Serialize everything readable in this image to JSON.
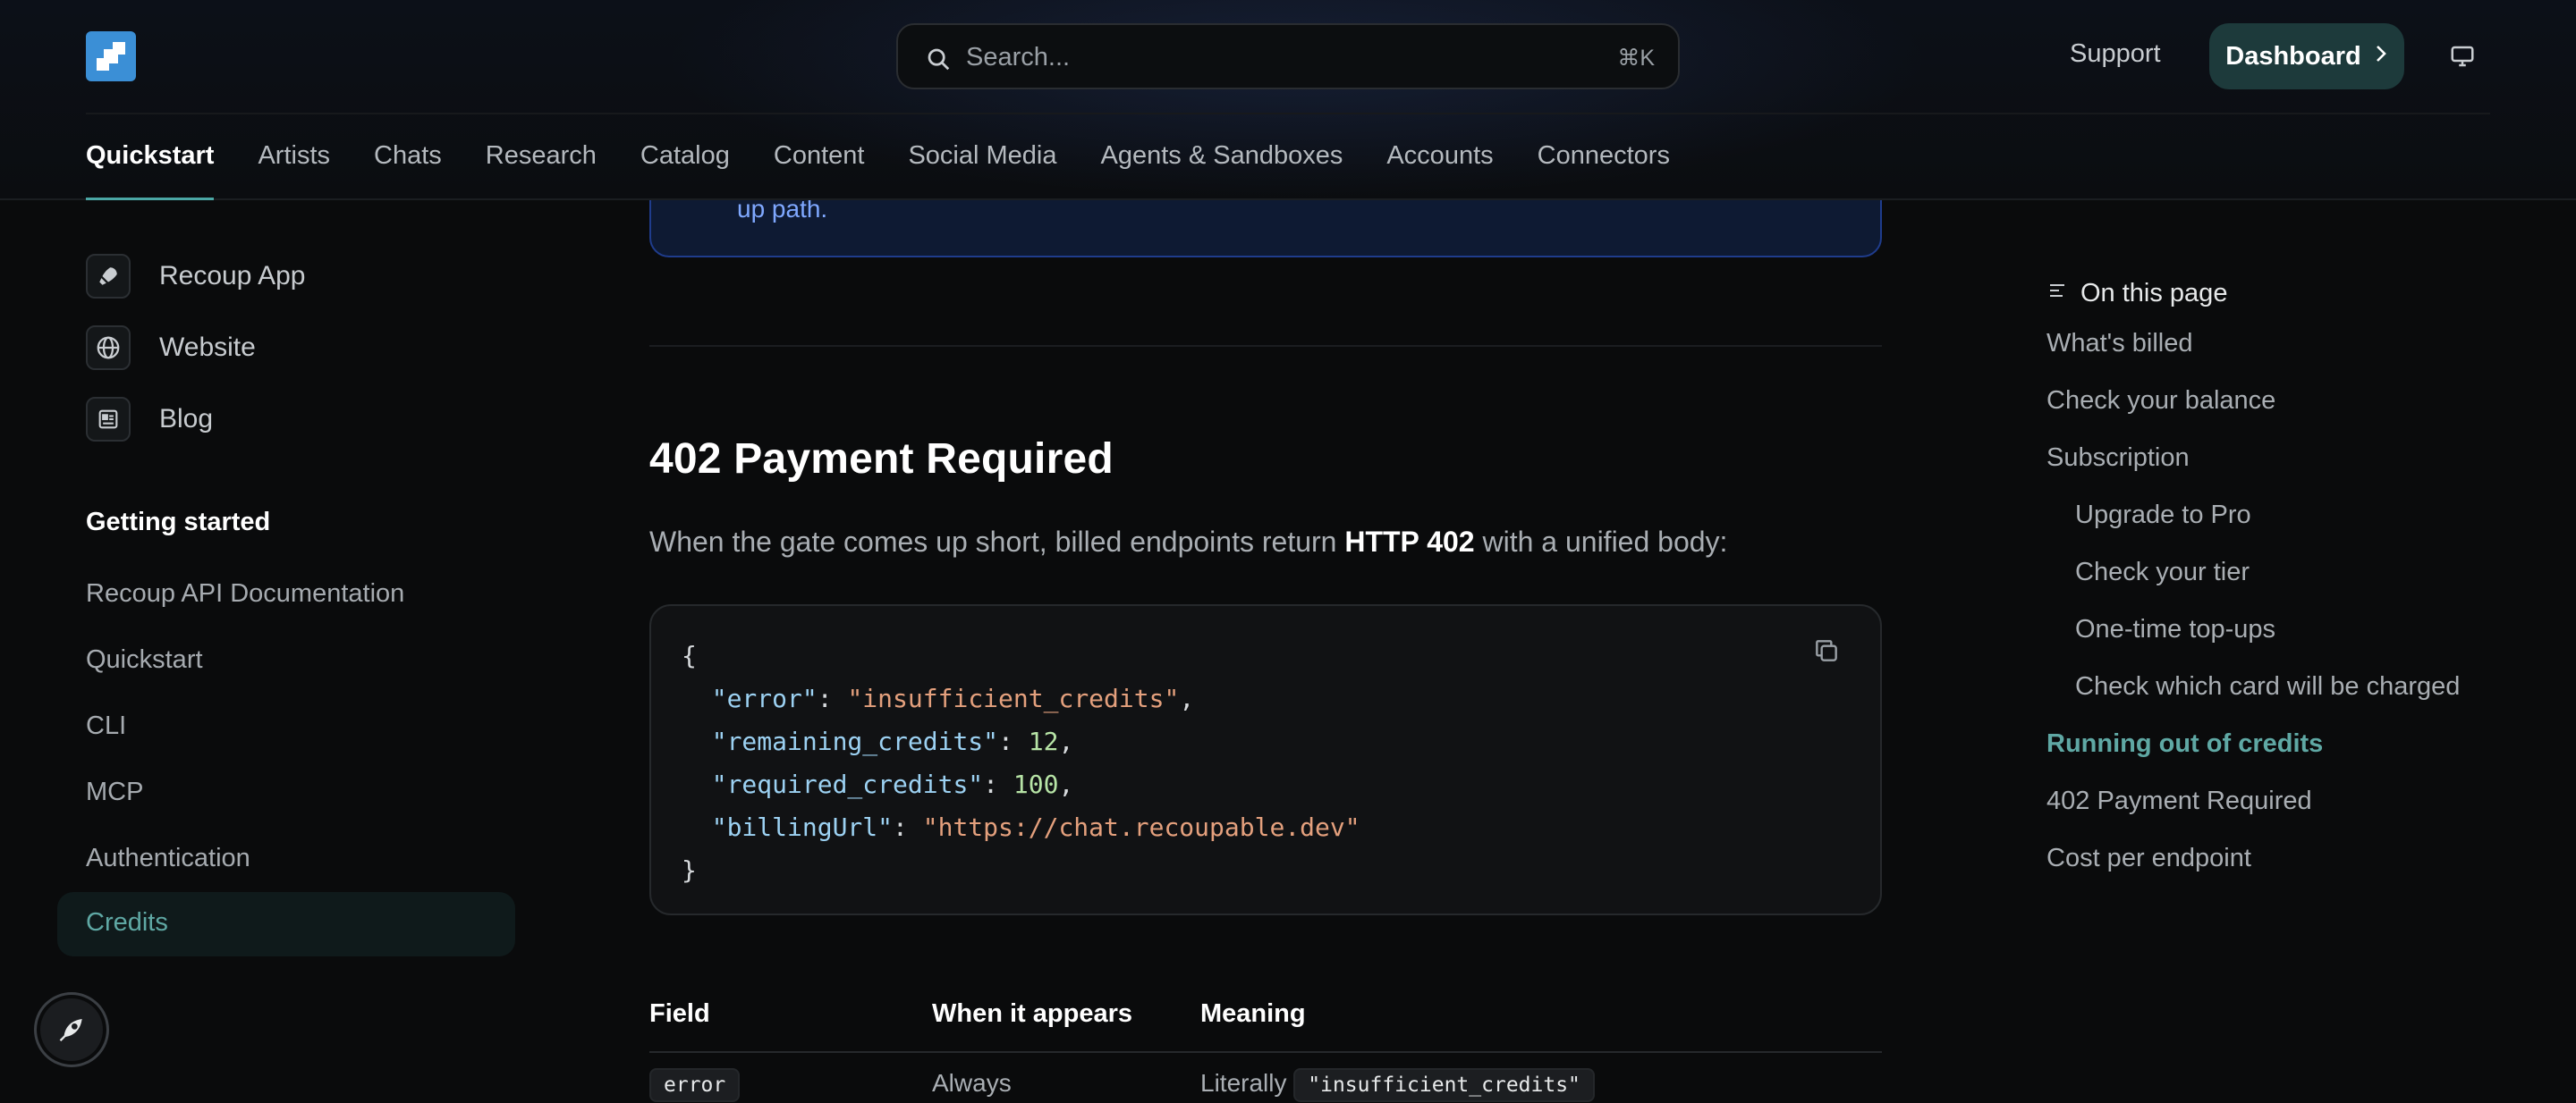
{
  "header": {
    "search_placeholder": "Search...",
    "search_shortcut": "⌘K",
    "support_label": "Support",
    "dashboard_label": "Dashboard",
    "tabs": [
      {
        "label": "Quickstart",
        "active": true
      },
      {
        "label": "Artists"
      },
      {
        "label": "Chats"
      },
      {
        "label": "Research"
      },
      {
        "label": "Catalog"
      },
      {
        "label": "Content"
      },
      {
        "label": "Social Media"
      },
      {
        "label": "Agents & Sandboxes"
      },
      {
        "label": "Accounts"
      },
      {
        "label": "Connectors"
      }
    ]
  },
  "sidebar": {
    "links": [
      {
        "label": "Recoup App",
        "icon": "rocket-icon"
      },
      {
        "label": "Website",
        "icon": "globe-icon"
      },
      {
        "label": "Blog",
        "icon": "newspaper-icon"
      }
    ],
    "section_title": "Getting started",
    "items": [
      {
        "label": "Recoup API Documentation"
      },
      {
        "label": "Quickstart"
      },
      {
        "label": "CLI"
      },
      {
        "label": "MCP"
      },
      {
        "label": "Authentication"
      },
      {
        "label": "Credits",
        "active": true
      }
    ]
  },
  "main": {
    "callout_text": "up path.",
    "heading": "402 Payment Required",
    "paragraph": {
      "before": "When the gate comes up short, billed endpoints return ",
      "bold": "HTTP 402",
      "after": " with a unified body:"
    },
    "code": {
      "open": "{",
      "close": "}",
      "lines": [
        {
          "key": "\"error\"",
          "value": "\"insufficient_credits\"",
          "type": "string",
          "comma": ","
        },
        {
          "key": "\"remaining_credits\"",
          "value": "12",
          "type": "number",
          "comma": ","
        },
        {
          "key": "\"required_credits\"",
          "value": "100",
          "type": "number",
          "comma": ","
        },
        {
          "key": "\"billingUrl\"",
          "value": "\"https://chat.recoupable.dev\"",
          "type": "string",
          "comma": ""
        }
      ]
    },
    "table": {
      "headers": [
        "Field",
        "When it appears",
        "Meaning"
      ],
      "rows": [
        {
          "field": "error",
          "when": "Always",
          "meaning_prefix": "Literally",
          "meaning_code": "\"insufficient_credits\""
        }
      ]
    }
  },
  "toc": {
    "title": "On this page",
    "items": [
      {
        "label": "What's billed",
        "level": 1
      },
      {
        "label": "Check your balance",
        "level": 1
      },
      {
        "label": "Subscription",
        "level": 1
      },
      {
        "label": "Upgrade to Pro",
        "level": 2
      },
      {
        "label": "Check your tier",
        "level": 2
      },
      {
        "label": "One-time top-ups",
        "level": 2
      },
      {
        "label": "Check which card will be charged",
        "level": 2
      },
      {
        "label": "Running out of credits",
        "level": 1,
        "active": true
      },
      {
        "label": "402 Payment Required",
        "level": 1
      },
      {
        "label": "Cost per endpoint",
        "level": 1
      }
    ]
  },
  "colors": {
    "accent": "#4ba7a5",
    "active_text": "#5fa8a4",
    "dashboard_bg": "#1d3a3b",
    "callout_border": "#1f3c8c",
    "logo_blue": "#3b8fd6"
  }
}
